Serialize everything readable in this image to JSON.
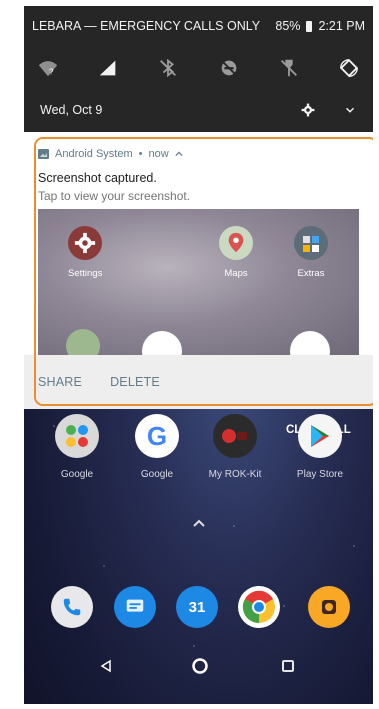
{
  "status_bar": {
    "carrier": "LEBARA — EMERGENCY CALLS ONLY",
    "battery": "85%",
    "time": "2:21 PM"
  },
  "quick_settings": {
    "date": "Wed, Oct 9",
    "wifi_badge": "?"
  },
  "notification": {
    "app_name": "Android System",
    "when": "now",
    "title": "Screenshot captured.",
    "text": "Tap to view your screenshot.",
    "preview_apps": [
      {
        "label": "Settings",
        "icon": "gear-icon"
      },
      {
        "label": "Maps",
        "icon": "maps-icon"
      },
      {
        "label": "Extras",
        "icon": "folder-icon"
      }
    ],
    "actions": {
      "share": "SHARE",
      "delete": "DELETE"
    },
    "highlight_color": "#e8902f"
  },
  "home": {
    "clear_all": "CLEAR ALL",
    "apps": [
      {
        "label": "Google",
        "icon": "google-folder-icon"
      },
      {
        "label": "Google",
        "icon": "google-icon"
      },
      {
        "label": "My ROK-Kit",
        "icon": "rok-kit-icon"
      },
      {
        "label": "Play Store",
        "icon": "play-store-icon"
      }
    ],
    "dock": [
      {
        "icon": "phone-icon"
      },
      {
        "icon": "messages-icon"
      },
      {
        "icon": "calendar-icon",
        "label": "31"
      },
      {
        "icon": "chrome-icon"
      },
      {
        "icon": "camera-icon"
      }
    ]
  },
  "colors": {
    "shade_bg": "#262626",
    "accent": "#607d8b",
    "highlight": "#e8902f"
  }
}
